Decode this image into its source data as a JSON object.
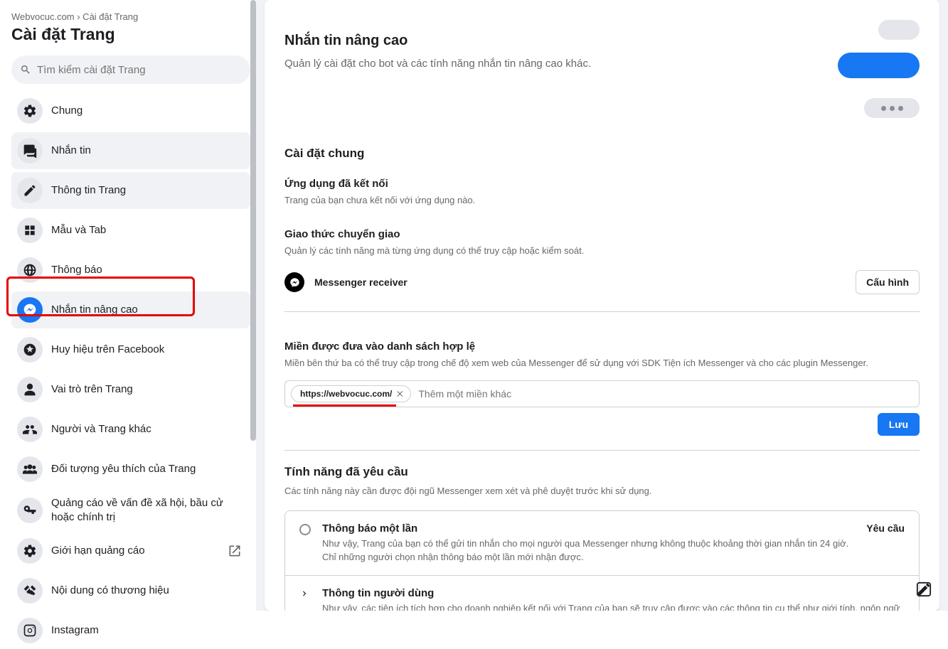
{
  "breadcrumb": "Webvocuc.com › Cài đặt Trang",
  "page_title": "Cài đặt Trang",
  "search_placeholder": "Tìm kiểm cài đặt Trang",
  "sidebar": {
    "items": [
      {
        "label": "Chung"
      },
      {
        "label": "Nhắn tin"
      },
      {
        "label": "Thông tin Trang"
      },
      {
        "label": "Mẫu và Tab"
      },
      {
        "label": "Thông báo"
      },
      {
        "label": "Nhắn tin nâng cao"
      },
      {
        "label": "Huy hiệu trên Facebook"
      },
      {
        "label": "Vai trò trên Trang"
      },
      {
        "label": "Người và Trang khác"
      },
      {
        "label": "Đối tượng yêu thích của Trang"
      },
      {
        "label": "Quảng cáo về vấn đề xã hội, bầu cử hoặc chính trị"
      },
      {
        "label": "Giới hạn quảng cáo"
      },
      {
        "label": "Nội dung có thương hiệu"
      },
      {
        "label": "Instagram"
      }
    ]
  },
  "hero": {
    "title": "Nhắn tin nâng cao",
    "subtitle": "Quản lý cài đặt cho bot và các tính năng nhắn tin nâng cao khác."
  },
  "general": {
    "title": "Cài đặt chung",
    "connected_apps_h": "Ứng dụng đã kết nối",
    "connected_apps_p": "Trang của bạn chưa kết nối với ứng dụng nào.",
    "handover_h": "Giao thức chuyển giao",
    "handover_p": "Quản lý các tính năng mà từng ứng dụng có thể truy cập hoặc kiểm soát.",
    "receiver_label": "Messenger receiver",
    "configure_btn": "Cấu hình"
  },
  "whitelist": {
    "title": "Miền được đưa vào danh sách hợp lệ",
    "desc": "Miền bên thứ ba có thể truy cập trong chế độ xem web của Messenger để sử dụng với SDK Tiện ích Messenger và cho các plugin Messenger.",
    "chip": "https://webvocuc.com/",
    "placeholder": "Thêm một miền khác",
    "save": "Lưu"
  },
  "requested": {
    "title": "Tính năng đã yêu cầu",
    "desc": "Các tính năng này cần được đội ngũ Messenger xem xét và phê duyệt trước khi sử dụng.",
    "f1_title": "Thông báo một lần",
    "f1_desc": "Như vậy, Trang của bạn có thể gửi tin nhắn cho mọi người qua Messenger nhưng không thuộc khoảng thời gian nhắn tin 24 giờ. Chỉ những người chọn nhận thông báo một lần mới nhận được.",
    "f1_action": "Yêu cầu",
    "f2_title": "Thông tin người dùng",
    "f2_desc": "Như vậy, các tiện ích tích hợp cho doanh nghiệp kết nối với Trang của bạn sẽ truy cập được vào các thông tin cụ thể như giới tính, ngôn ngữ và múi giờ của những người gửi tin nhắn cho bạn."
  }
}
